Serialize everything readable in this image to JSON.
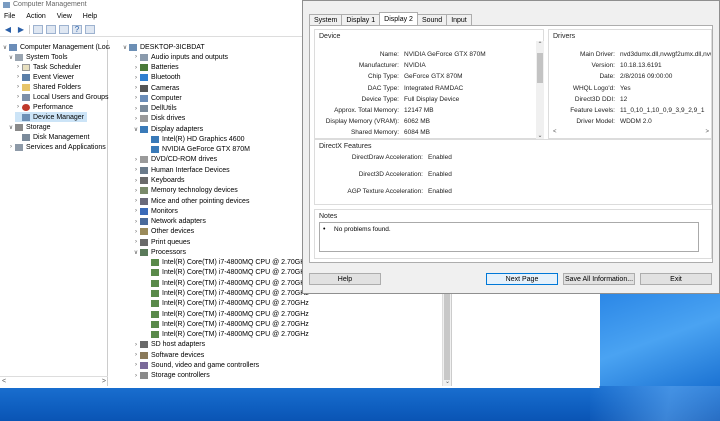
{
  "computer_management": {
    "title": "Computer Management",
    "menu": [
      "File",
      "Action",
      "View",
      "Help"
    ],
    "tree": {
      "root": "Computer Management (Local",
      "system_tools": "System Tools",
      "task_scheduler": "Task Scheduler",
      "event_viewer": "Event Viewer",
      "shared_folders": "Shared Folders",
      "local_users": "Local Users and Groups",
      "performance": "Performance",
      "device_manager": "Device Manager",
      "storage": "Storage",
      "disk_management": "Disk Management",
      "services": "Services and Applications"
    },
    "devices": {
      "computer": "DESKTOP-3ICBDAT",
      "categories": [
        "Audio inputs and outputs",
        "Batteries",
        "Bluetooth",
        "Cameras",
        "Computer",
        "DellUtils",
        "Disk drives",
        "Display adapters"
      ],
      "display_adapters": [
        "Intel(R) HD Graphics 4600",
        "NVIDIA GeForce GTX 870M"
      ],
      "categories2": [
        "DVD/CD-ROM drives",
        "Human Interface Devices",
        "Keyboards",
        "Memory technology devices",
        "Mice and other pointing devices",
        "Monitors",
        "Network adapters",
        "Other devices",
        "Print queues",
        "Processors"
      ],
      "processors": [
        "Intel(R) Core(TM) i7-4800MQ CPU @ 2.70GHz",
        "Intel(R) Core(TM) i7-4800MQ CPU @ 2.70GHz",
        "Intel(R) Core(TM) i7-4800MQ CPU @ 2.70GHz",
        "Intel(R) Core(TM) i7-4800MQ CPU @ 2.70GHz",
        "Intel(R) Core(TM) i7-4800MQ CPU @ 2.70GHz",
        "Intel(R) Core(TM) i7-4800MQ CPU @ 2.70GHz",
        "Intel(R) Core(TM) i7-4800MQ CPU @ 2.70GHz",
        "Intel(R) Core(TM) i7-4800MQ CPU @ 2.70GHz"
      ],
      "categories3": [
        "SD host adapters",
        "Software devices",
        "Sound, video and game controllers",
        "Storage controllers"
      ]
    }
  },
  "dxdiag": {
    "tabs": [
      "System",
      "Display 1",
      "Display 2",
      "Sound",
      "Input"
    ],
    "device_group": "Device",
    "device": [
      {
        "k": "Name:",
        "v": "NVIDIA GeForce GTX 870M"
      },
      {
        "k": "Manufacturer:",
        "v": "NVIDIA"
      },
      {
        "k": "Chip Type:",
        "v": "GeForce GTX 870M"
      },
      {
        "k": "DAC Type:",
        "v": "Integrated RAMDAC"
      },
      {
        "k": "Device Type:",
        "v": "Full Display Device"
      },
      {
        "k": "Approx. Total Memory:",
        "v": "12147 MB"
      },
      {
        "k": "Display Memory (VRAM):",
        "v": "6062 MB"
      },
      {
        "k": "Shared Memory:",
        "v": "6084 MB"
      }
    ],
    "drivers_group": "Drivers",
    "drivers": [
      {
        "k": "Main Driver:",
        "v": "nvd3dumx.dll,nvwgf2umx.dll,nvwgf2u"
      },
      {
        "k": "Version:",
        "v": "10.18.13.6191"
      },
      {
        "k": "Date:",
        "v": "2/8/2016 09:00:00"
      },
      {
        "k": "WHQL Logo'd:",
        "v": "Yes"
      },
      {
        "k": "Direct3D DDI:",
        "v": "12"
      },
      {
        "k": "Feature Levels:",
        "v": "11_0,10_1,10_0,9_3,9_2,9_1"
      },
      {
        "k": "Driver Model:",
        "v": "WDDM 2.0"
      }
    ],
    "directx_group": "DirectX Features",
    "directx": [
      {
        "k": "DirectDraw Acceleration:",
        "v": "Enabled"
      },
      {
        "k": "Direct3D Acceleration:",
        "v": "Enabled"
      },
      {
        "k": "AGP Texture Acceleration:",
        "v": "Enabled"
      }
    ],
    "notes_group": "Notes",
    "notes_item": "No problems found.",
    "buttons": {
      "help": "Help",
      "next": "Next Page",
      "save": "Save All Information...",
      "exit": "Exit"
    }
  }
}
